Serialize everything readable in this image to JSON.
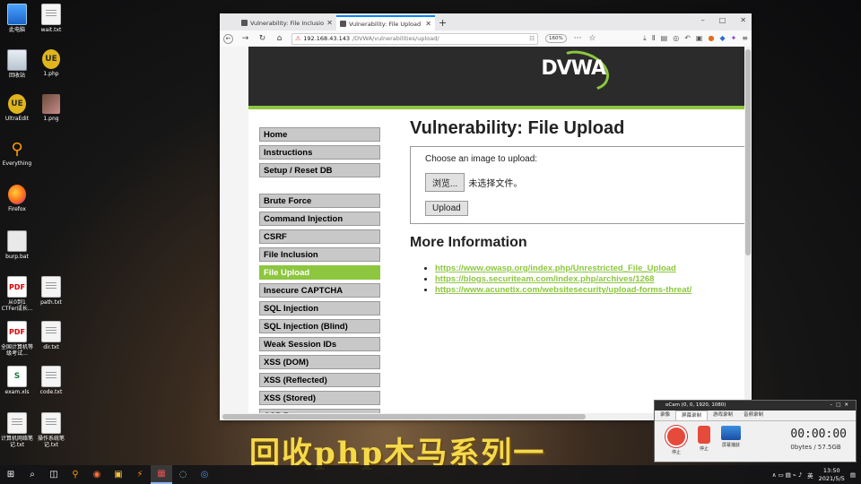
{
  "desktop": {
    "icons": [
      {
        "label": "此电脑",
        "glyph": ""
      },
      {
        "label": "wait.txt",
        "glyph": ""
      },
      {
        "label": "回收站",
        "glyph": ""
      },
      {
        "label": "1.php",
        "glyph": "UE"
      },
      {
        "label": "UltraEdit",
        "glyph": "UE"
      },
      {
        "label": "1.png",
        "glyph": ""
      },
      {
        "label": "Everything",
        "glyph": "⚲"
      },
      {
        "label": "Firefox",
        "glyph": ""
      },
      {
        "label": "burp.bat",
        "glyph": ""
      },
      {
        "label": "从0到1 CTFer成长...",
        "glyph": "PDF"
      },
      {
        "label": "path.txt",
        "glyph": ""
      },
      {
        "label": "全国计算机等级考试...",
        "glyph": "PDF"
      },
      {
        "label": "dir.txt",
        "glyph": ""
      },
      {
        "label": "exam.xls",
        "glyph": "S"
      },
      {
        "label": "code.txt",
        "glyph": ""
      },
      {
        "label": "计算机网络笔记.txt",
        "glyph": ""
      },
      {
        "label": "操作系统笔记.txt",
        "glyph": ""
      }
    ]
  },
  "browser": {
    "tabs": [
      {
        "label": "Vulnerability: File Inclusion :: D"
      },
      {
        "label": "Vulnerability: File Upload :: D"
      }
    ],
    "new_tab": "+",
    "controls": {
      "minimize": "–",
      "maximize": "□",
      "close": "✕"
    },
    "url": {
      "host": "192.168.43.143",
      "path": "/DVWA/vulnerabilities/upload/"
    },
    "zoom": "160%",
    "nav_glyphs": {
      "back": "←",
      "forward": "→",
      "reload": "↻",
      "home": "⌂",
      "lock": "⚠",
      "qr": "☷",
      "more": "···",
      "star": "☆"
    },
    "tool_glyphs": [
      "⤓",
      "Ⅱ",
      "▤",
      "◎",
      "↶",
      "▣",
      "●",
      "◆",
      "✦",
      "≡"
    ]
  },
  "dvwa": {
    "logo": "DVWA",
    "menu_top": [
      "Home",
      "Instructions",
      "Setup / Reset DB"
    ],
    "menu_vuln": [
      "Brute Force",
      "Command Injection",
      "CSRF",
      "File Inclusion",
      "File Upload",
      "Insecure CAPTCHA",
      "SQL Injection",
      "SQL Injection (Blind)",
      "Weak Session IDs",
      "XSS (DOM)",
      "XSS (Reflected)",
      "XSS (Stored)",
      "CSP Bypass"
    ],
    "active_item": "File Upload",
    "title": "Vulnerability: File Upload",
    "upload_prompt": "Choose an image to upload:",
    "browse_button": "浏览...",
    "no_file_text": "未选择文件。",
    "upload_button": "Upload",
    "more_info_heading": "More Information",
    "links": [
      "https://www.owasp.org/index.php/Unrestricted_File_Upload",
      "https://blogs.securiteam.com/index.php/archives/1268",
      "https://www.acunetix.com/websitesecurity/upload-forms-threat/"
    ]
  },
  "ocam": {
    "title": "oCam (0, 0, 1920, 1080)",
    "window_controls": "–□✕",
    "tabs": [
      "录像",
      "屏幕录制",
      "游戏录制",
      "音频录制"
    ],
    "active_tab": "屏幕录制",
    "buttons": [
      "停止",
      "停止",
      "屏幕捕获"
    ],
    "time": "00:00:00",
    "size": "0bytes / 57.5GB"
  },
  "subtitle": "回收php木马系列一",
  "taskbar": {
    "start_glyph": "⊞",
    "icons": [
      "⌕",
      "◫",
      "⚲",
      "◉",
      "▣",
      "⚡",
      "▦",
      "◌",
      "◎"
    ],
    "tray_glyphs": "∧ ▭ ▤ ⌁ ♪",
    "ime": "英",
    "time": "13:50",
    "date": "2021/5/5",
    "notif": "▤"
  }
}
